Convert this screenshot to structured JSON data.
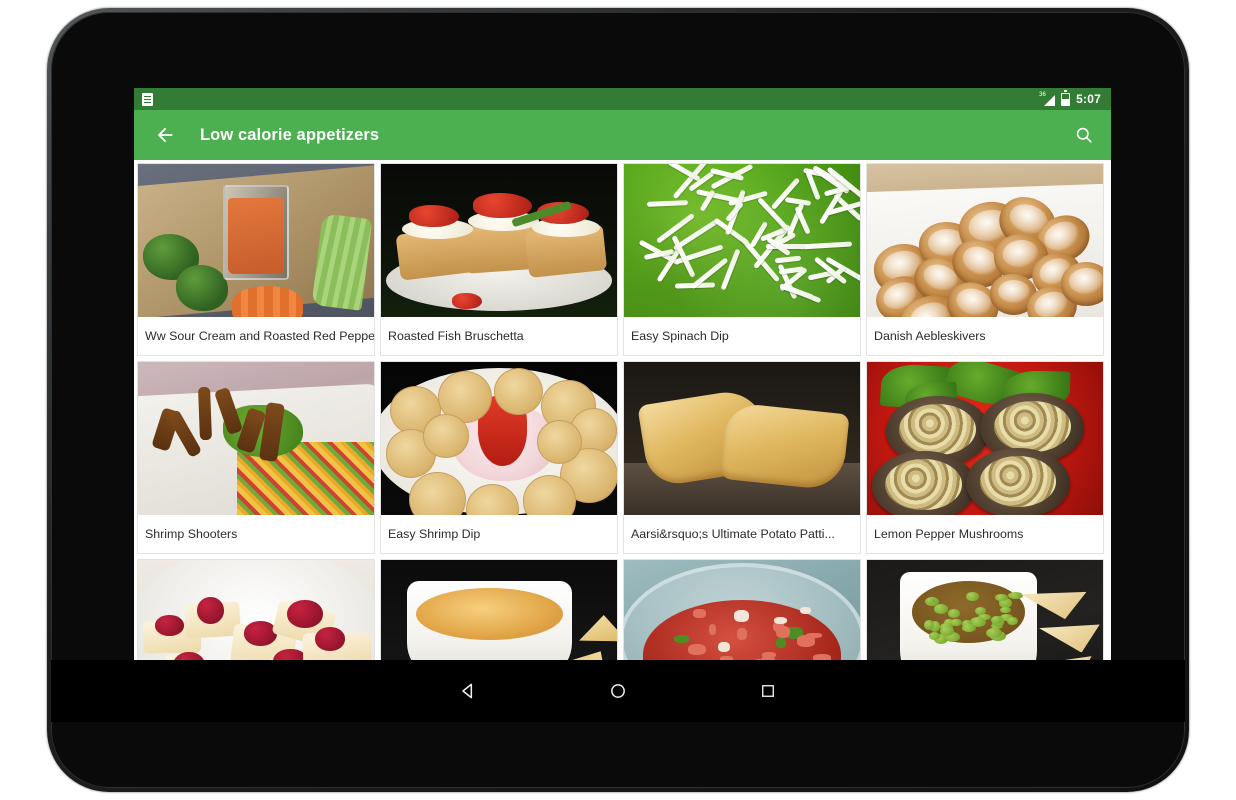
{
  "status_bar": {
    "notification_icon": "document-notification-icon",
    "signal_icon": "signal-bars-icon",
    "signal_superscript": "36",
    "battery_icon": "battery-icon",
    "clock": "5:07"
  },
  "app_bar": {
    "back_icon": "back-arrow-icon",
    "title": "Low calorie appetizers",
    "search_icon": "search-icon",
    "background_color": "#4caf50",
    "status_background_color": "#327c35"
  },
  "grid": {
    "rows": [
      [
        {
          "title": "Ww Sour Cream and Roasted Red Peppe...",
          "art": "a1"
        },
        {
          "title": "Roasted Fish Bruschetta",
          "art": "a2"
        },
        {
          "title": "Easy Spinach Dip",
          "art": "a3"
        },
        {
          "title": "Danish Aebleskivers",
          "art": "a4"
        }
      ],
      [
        {
          "title": "Shrimp Shooters",
          "art": "a5"
        },
        {
          "title": "Easy Shrimp Dip",
          "art": "a6"
        },
        {
          "title": "Aarsi&rsquo;s Ultimate Potato Patti...",
          "art": "a7"
        },
        {
          "title": "Lemon Pepper Mushrooms",
          "art": "a8"
        }
      ],
      [
        {
          "title": "",
          "art": "a9"
        },
        {
          "title": "",
          "art": "a10"
        },
        {
          "title": "",
          "art": "a11"
        },
        {
          "title": "",
          "art": "a12"
        }
      ]
    ]
  },
  "nav_bar": {
    "back_label": "back-triangle-icon",
    "home_label": "home-circle-icon",
    "recents_label": "recents-square-icon"
  }
}
